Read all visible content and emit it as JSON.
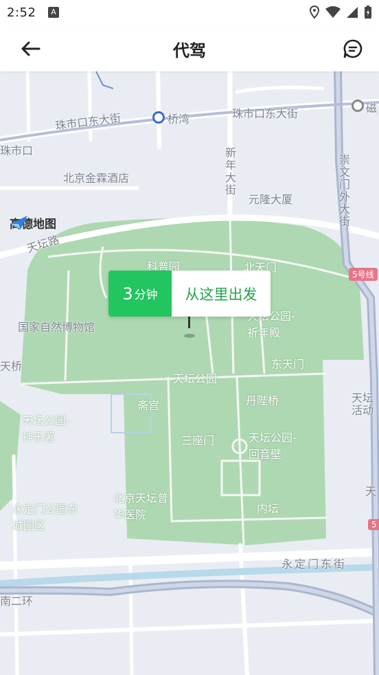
{
  "status_bar": {
    "time": "2:52",
    "notification_icon": "A"
  },
  "header": {
    "title": "代驾",
    "back_icon": "arrow-left-icon",
    "message_icon": "message-icon"
  },
  "map": {
    "logo_text": "高德地图",
    "labels": {
      "zhushikou_east": "珠市口东大街",
      "zhushikou_east_right": "珠市口东大街",
      "qiaowan": "桥湾",
      "zhushikou": "珠市口",
      "jinlin_hotel": "北京金霖酒店",
      "xinnian_street": "新年大街",
      "yuanlong": "元隆大厦",
      "chongwenmen": "崇文门外大街",
      "ci": "磁",
      "tiantan_road": "天坛路",
      "kepu": "科普园",
      "north_gate": "北天门",
      "line5": "5号线",
      "museum": "国家自然博物馆",
      "qiniandian": "天坛公园-祈年殿",
      "tianqiao": "天桥",
      "east_gate": "东天门",
      "tiantan_park": "天坛公园",
      "zhaigong": "斋宫",
      "danbiqiao": "丹陛桥",
      "tiantan_right": "天坛",
      "huodong": "活动",
      "shenyueshu": "天坛公园-神乐署",
      "sanzuomen": "三座门",
      "huiyinbi": "天坛公园-回音壁",
      "yongdingmen_park": "永定门公园东城园区",
      "puhua": "北京天坛普华医院",
      "neitan": "内坛",
      "tian_right2": "天",
      "yongdingmen_east": "永定门东街",
      "south_ring": "南二环",
      "line5b": "5"
    }
  },
  "callout": {
    "eta_number": "3",
    "eta_unit": "分钟",
    "action": "从这里出发"
  },
  "colors": {
    "accent": "#22c55e",
    "park": "#aed8b1",
    "road": "#ffffff",
    "background": "#e9edf3"
  }
}
